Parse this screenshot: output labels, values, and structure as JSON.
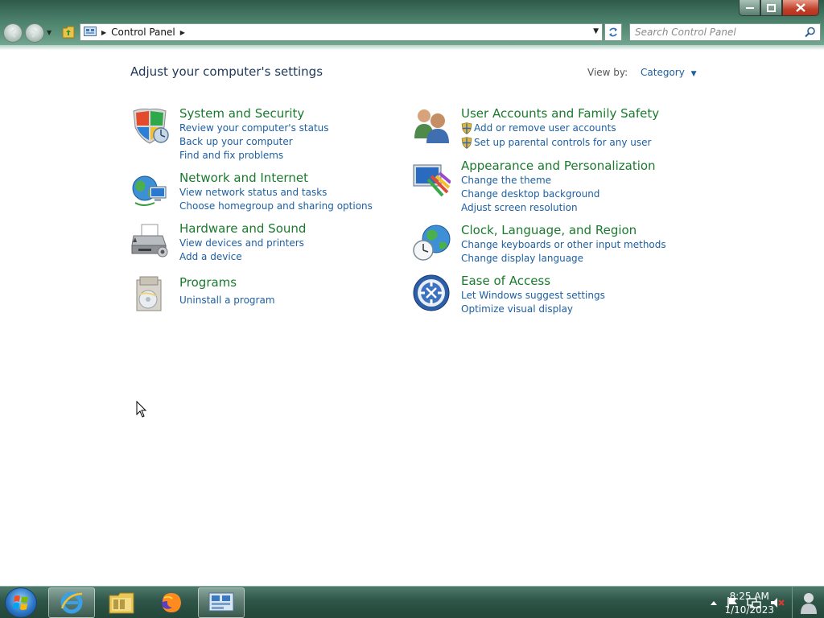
{
  "address": {
    "breadcrumb": "Control Panel"
  },
  "search": {
    "placeholder": "Search Control Panel"
  },
  "content": {
    "heading": "Adjust your computer's settings",
    "view_by_label": "View by:",
    "view_by_value": "Category"
  },
  "categories": [
    {
      "title": "System and Security",
      "icon": "shield-icon",
      "links": [
        "Review your computer's status",
        "Back up your computer",
        "Find and fix problems"
      ]
    },
    {
      "title": "Network and Internet",
      "icon": "network-icon",
      "links": [
        "View network status and tasks",
        "Choose homegroup and sharing options"
      ]
    },
    {
      "title": "Hardware and Sound",
      "icon": "printer-icon",
      "links": [
        "View devices and printers",
        "Add a device"
      ]
    },
    {
      "title": "Programs",
      "icon": "programs-icon",
      "links": [
        "Uninstall a program"
      ]
    },
    {
      "title": "User Accounts and Family Safety",
      "icon": "users-icon",
      "links": [
        "Add or remove user accounts",
        "Set up parental controls for any user"
      ]
    },
    {
      "title": "Appearance and Personalization",
      "icon": "appearance-icon",
      "links": [
        "Change the theme",
        "Change desktop background",
        "Adjust screen resolution"
      ]
    },
    {
      "title": "Clock, Language, and Region",
      "icon": "clock-globe-icon",
      "links": [
        "Change keyboards or other input methods",
        "Change display language"
      ]
    },
    {
      "title": "Ease of Access",
      "icon": "ease-of-access-icon",
      "links": [
        "Let Windows suggest settings",
        "Optimize visual display"
      ]
    }
  ],
  "taskbar": {
    "apps": [
      "internet-explorer-icon",
      "file-explorer-icon",
      "firefox-icon",
      "control-panel-icon"
    ],
    "time": "8:25 AM",
    "date": "1/10/2023"
  },
  "colors": {
    "category_title": "#1a7a2e",
    "link": "#1e5fa0",
    "heading": "#1e395b"
  }
}
